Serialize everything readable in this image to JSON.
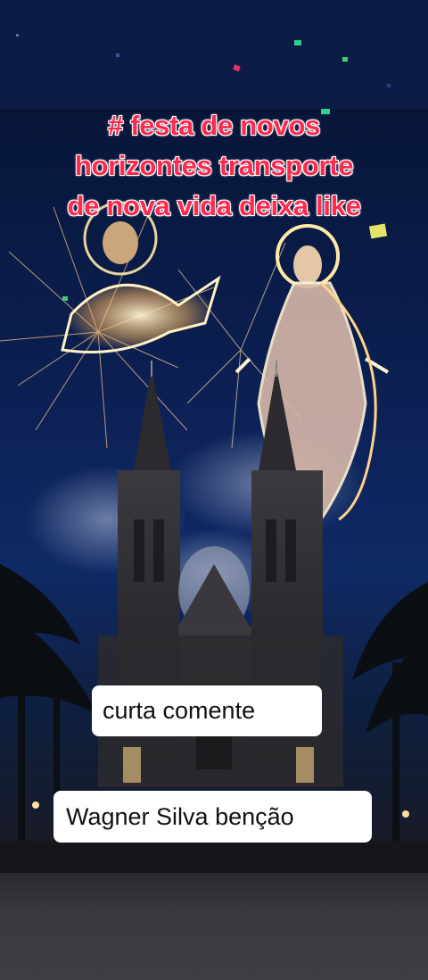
{
  "overlay_title": {
    "lines": [
      "# festa de novos",
      "horizontes transporte",
      "de nova vida deixa like"
    ]
  },
  "captions": {
    "first": "curta comente",
    "second": "Wagner Silva benção"
  },
  "colors": {
    "title_text": "#ff2a4e",
    "caption_bg": "#ffffff",
    "sky": "#0b1f52"
  },
  "scene": {
    "subject": "cathedral-with-fireworks-and-glowing-saints"
  }
}
